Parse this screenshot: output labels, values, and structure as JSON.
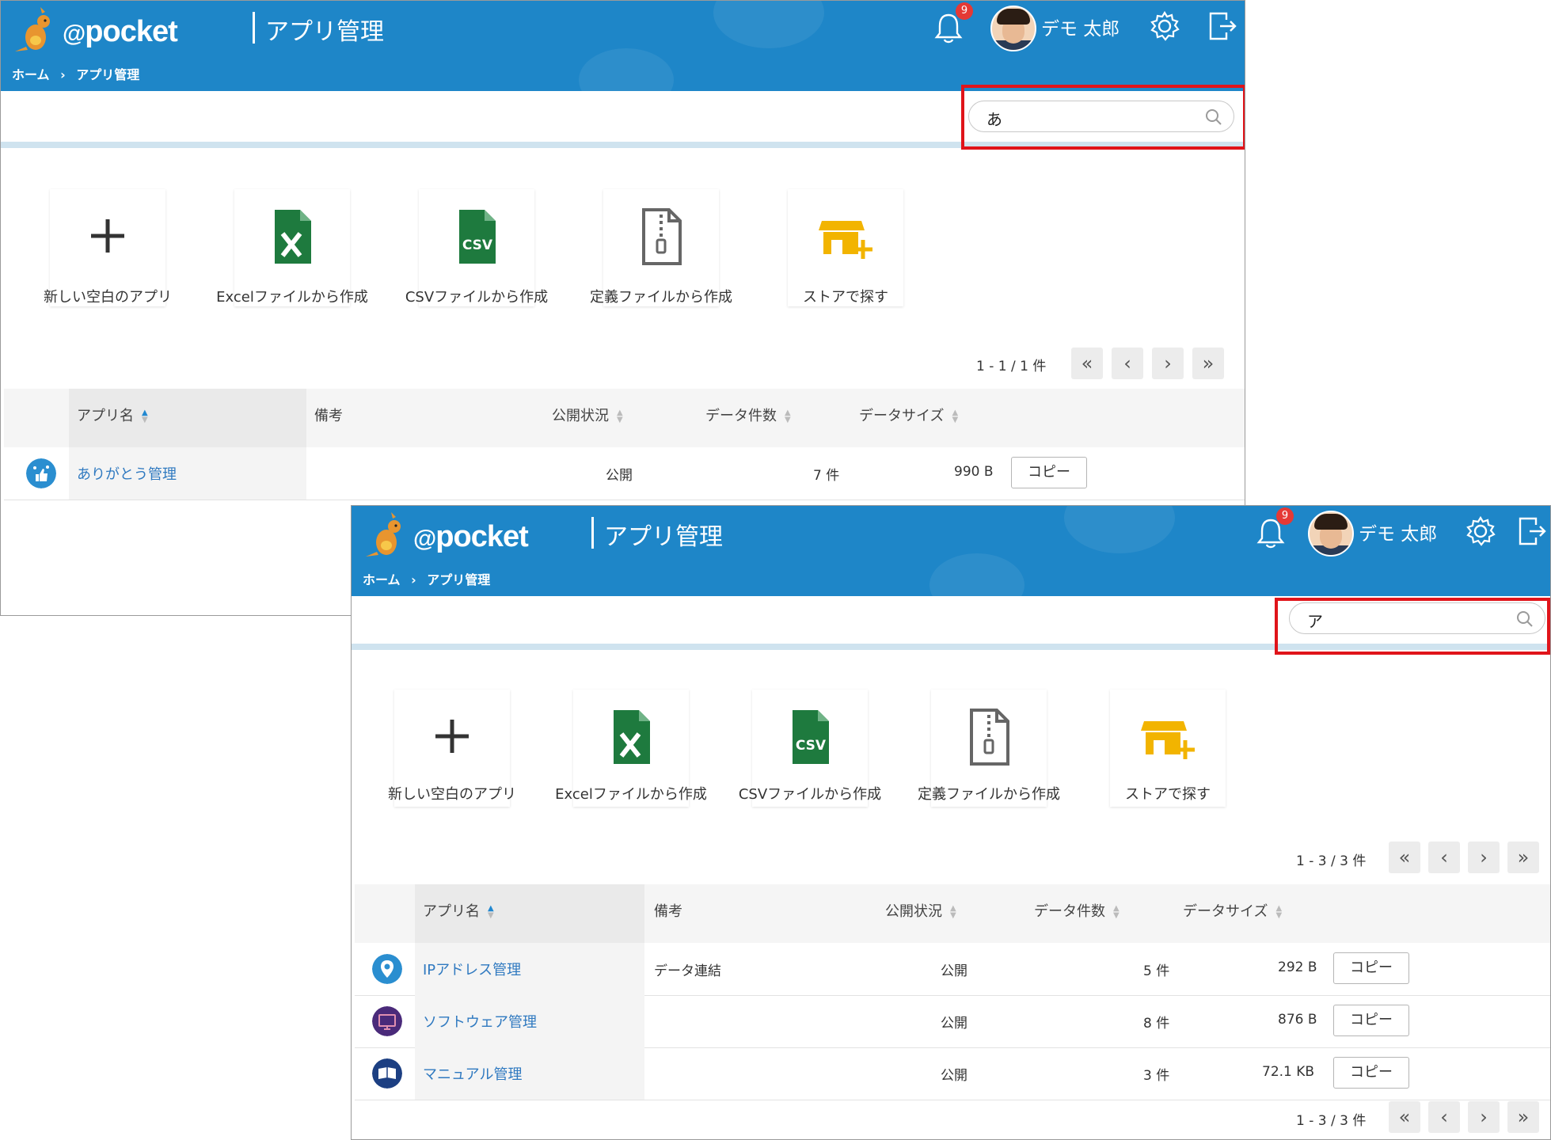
{
  "header": {
    "brand": "pocket",
    "brand_at": "@",
    "title": "アプリ管理",
    "breadcrumb": [
      "ホーム",
      "›",
      "アプリ管理"
    ],
    "notification_count": "9",
    "user_name": "デモ 太郎"
  },
  "actions": [
    {
      "label": "新しい空白のアプリ",
      "icon": "plus-icon"
    },
    {
      "label": "Excelファイルから作成",
      "icon": "excel-file-icon"
    },
    {
      "label": "CSVファイルから作成",
      "icon": "csv-file-icon"
    },
    {
      "label": "定義ファイルから作成",
      "icon": "zip-file-icon"
    },
    {
      "label": "ストアで探す",
      "icon": "store-icon"
    }
  ],
  "table_headers": {
    "name": "アプリ名",
    "note": "備考",
    "status": "公開状況",
    "count": "データ件数",
    "size": "データサイズ"
  },
  "icons": {
    "excel_green": "#1e7a3e",
    "csv_green": "#1e7a3e",
    "store_yellow": "#f2b400",
    "accent_blue": "#1e86c8",
    "highlight_red": "#e0141a"
  },
  "screens": [
    {
      "search_value": "あ",
      "pager_top": "1 - 1 / 1 件",
      "rows": [
        {
          "name": "ありがとう管理",
          "note": "",
          "status": "公開",
          "count": "7 件",
          "size": "990 B",
          "copy": "コピー"
        }
      ]
    },
    {
      "search_value": "ア",
      "pager_top": "1 - 3 / 3 件",
      "pager_bottom": "1 - 3 / 3 件",
      "rows": [
        {
          "name": "IPアドレス管理",
          "note": "データ連結",
          "status": "公開",
          "count": "5 件",
          "size": "292 B",
          "copy": "コピー"
        },
        {
          "name": "ソフトウェア管理",
          "note": "",
          "status": "公開",
          "count": "8 件",
          "size": "876 B",
          "copy": "コピー"
        },
        {
          "name": "マニュアル管理",
          "note": "",
          "status": "公開",
          "count": "3 件",
          "size": "72.1 KB",
          "copy": "コピー"
        }
      ]
    }
  ]
}
